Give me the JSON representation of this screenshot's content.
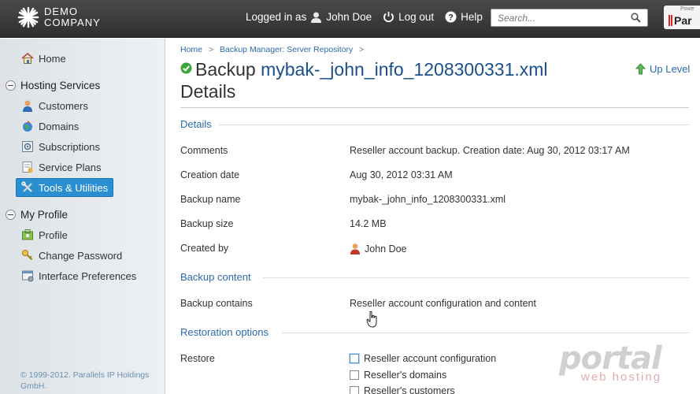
{
  "header": {
    "logo_line1": "DEMO",
    "logo_line2": "COMPANY",
    "logged_in_as": "Logged in as",
    "user_name": "John Doe",
    "logout_label": "Log out",
    "help_label": "Help",
    "search_placeholder": "Search...",
    "brand_small": "Powe",
    "brand_big": "Par"
  },
  "sidebar": {
    "home": "Home",
    "hosting_services": "Hosting Services",
    "customers": "Customers",
    "domains": "Domains",
    "subscriptions": "Subscriptions",
    "service_plans": "Service Plans",
    "tools_utilities": "Tools & Utilities",
    "my_profile": "My Profile",
    "profile": "Profile",
    "change_password": "Change Password",
    "interface_preferences": "Interface Preferences",
    "copyright": "© 1999-2012. Parallels IP Holdings GmbH."
  },
  "breadcrumb": {
    "home": "Home",
    "separator": ">",
    "repo": "Backup Manager: Server Repository"
  },
  "page": {
    "title_prefix": "Backup",
    "title_name": "mybak-_john_info_1208300331.xml",
    "title_suffix": "Details",
    "up_level": "Up Level"
  },
  "details": {
    "section_title": "Details",
    "rows": [
      {
        "label": "Comments",
        "value": "Reseller account backup. Creation date: Aug 30, 2012 03:17 AM"
      },
      {
        "label": "Creation date",
        "value": "Aug 30, 2012 03:31 AM"
      },
      {
        "label": "Backup name",
        "value": "mybak-_john_info_1208300331.xml"
      },
      {
        "label": "Backup size",
        "value": "14.2 MB"
      },
      {
        "label": "Created by",
        "value": "John Doe"
      }
    ]
  },
  "backup_content": {
    "section_title": "Backup content",
    "label": "Backup contains",
    "value": "Reseller account configuration and content"
  },
  "restoration": {
    "section_title": "Restoration options",
    "label": "Restore",
    "options": [
      {
        "label": "Reseller account configuration",
        "checked": false
      },
      {
        "label": "Reseller's domains",
        "checked": false
      },
      {
        "label": "Reseller's customers",
        "checked": false
      }
    ]
  },
  "watermark": {
    "line1": "portal",
    "line2": "web hosting"
  },
  "colors": {
    "accent": "#2b6bab",
    "active_nav": "#2a8fd0",
    "topbar": "#3a3a3a"
  }
}
